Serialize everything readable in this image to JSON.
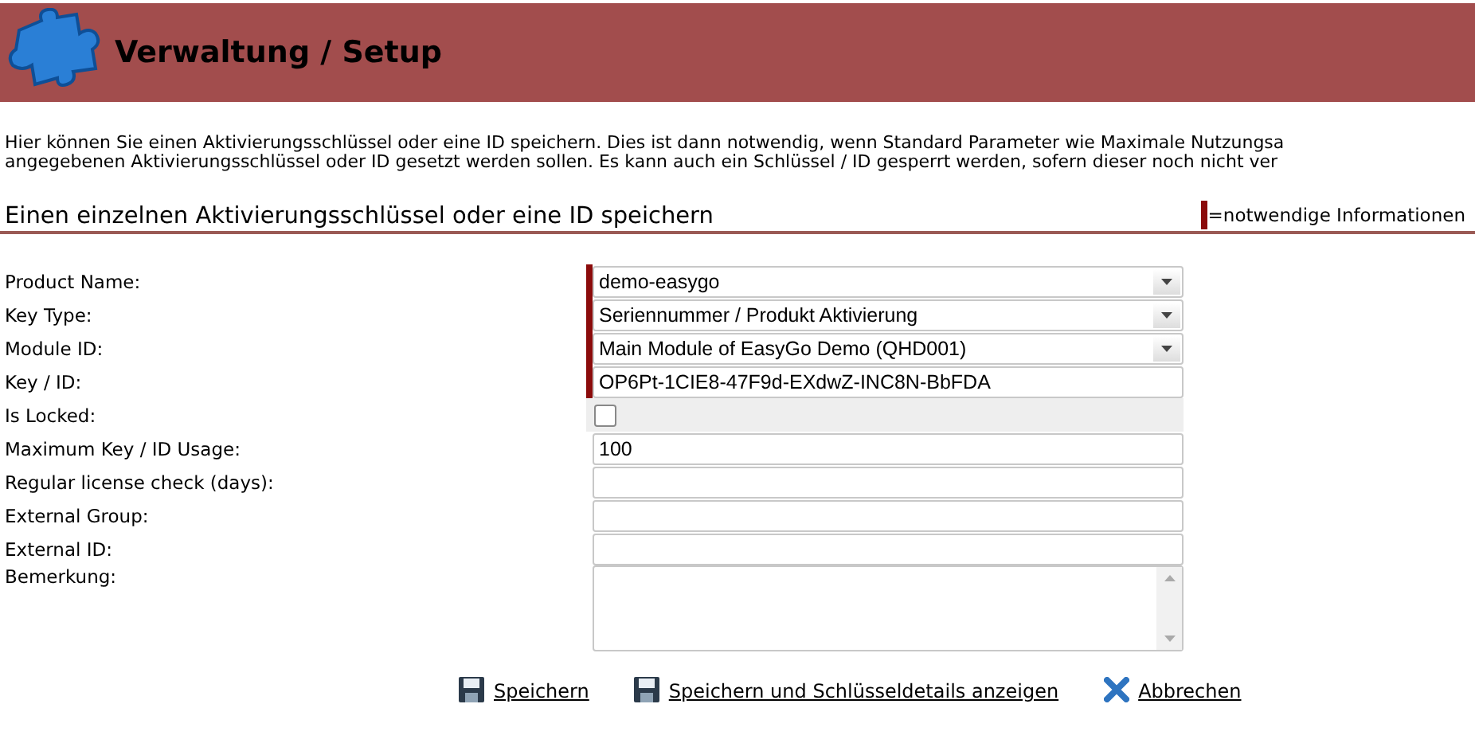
{
  "header": {
    "title": "Verwaltung / Setup"
  },
  "intro": [
    "Hier können Sie einen Aktivierungsschlüssel oder eine ID speichern. Dies ist dann notwendig, wenn Standard Parameter wie Maximale Nutzungsa",
    "angegebenen Aktivierungsschlüssel oder ID gesetzt werden sollen. Es kann auch ein Schlüssel / ID gesperrt werden, sofern dieser noch nicht ver"
  ],
  "section": {
    "title": "Einen einzelnen Aktivierungsschlüssel oder eine ID speichern",
    "legend": "=notwendige Informationen"
  },
  "fields": [
    {
      "label": "Product Name:",
      "kind": "select",
      "value": "demo-easygo",
      "required": true
    },
    {
      "label": "Key Type:",
      "kind": "select",
      "value": "Seriennummer / Produkt Aktivierung",
      "required": true
    },
    {
      "label": "Module ID:",
      "kind": "select",
      "value": "Main Module of EasyGo Demo (QHD001)",
      "required": true
    },
    {
      "label": "Key / ID:",
      "kind": "text",
      "value": "OP6Pt-1CIE8-47F9d-EXdwZ-INC8N-BbFDA",
      "required": true
    },
    {
      "label": "Is Locked:",
      "kind": "checkbox",
      "checked": false,
      "required": false
    },
    {
      "label": "Maximum Key / ID Usage:",
      "kind": "text",
      "value": "100",
      "required": false
    },
    {
      "label": "Regular license check (days):",
      "kind": "text",
      "required": false
    },
    {
      "label": "External Group:",
      "kind": "text",
      "required": false
    },
    {
      "label": "External ID:",
      "kind": "text",
      "required": false
    },
    {
      "label": "Bemerkung:",
      "kind": "textarea",
      "required": false
    }
  ],
  "actions": [
    {
      "label": "Speichern",
      "kind": "save"
    },
    {
      "label": "Speichern und Schlüsseldetails anzeigen",
      "kind": "save"
    },
    {
      "label": "Abbrechen",
      "kind": "cancel"
    }
  ]
}
